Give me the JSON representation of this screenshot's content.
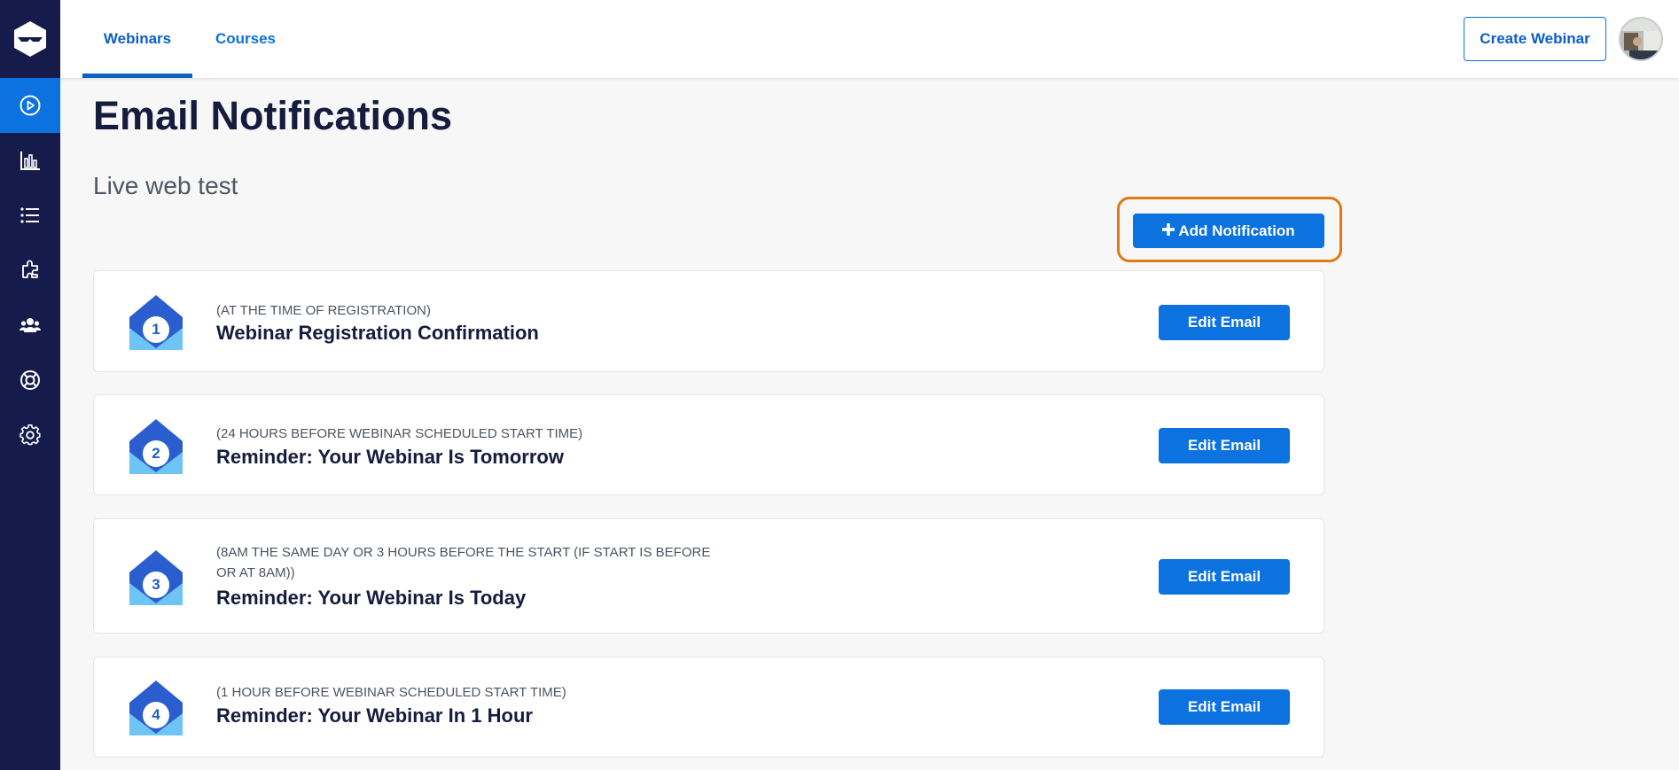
{
  "nav": {
    "tabs": [
      {
        "label": "Webinars",
        "active": true
      },
      {
        "label": "Courses",
        "active": false
      }
    ],
    "create_button": "Create Webinar"
  },
  "sidebar": {
    "items": [
      {
        "icon": "play-circle-icon",
        "active": true
      },
      {
        "icon": "bar-chart-icon",
        "active": false
      },
      {
        "icon": "list-icon",
        "active": false
      },
      {
        "icon": "puzzle-icon",
        "active": false
      },
      {
        "icon": "users-icon",
        "active": false
      },
      {
        "icon": "lifebuoy-icon",
        "active": false
      },
      {
        "icon": "gear-icon",
        "active": false
      }
    ]
  },
  "page": {
    "title": "Email Notifications",
    "subtitle": "Live web test",
    "add_button": "Add Notification"
  },
  "notifications": [
    {
      "number": "1",
      "timing": "(AT THE TIME OF REGISTRATION)",
      "title": "Webinar Registration Confirmation",
      "button": "Edit Email"
    },
    {
      "number": "2",
      "timing": "(24 HOURS BEFORE WEBINAR SCHEDULED START TIME)",
      "title": "Reminder: Your Webinar Is Tomorrow",
      "button": "Edit Email"
    },
    {
      "number": "3",
      "timing": "(8AM THE SAME DAY OR 3 HOURS BEFORE THE START (IF START IS BEFORE OR AT 8AM))",
      "title": "Reminder: Your Webinar Is Today",
      "button": "Edit Email"
    },
    {
      "number": "4",
      "timing": "(1 HOUR BEFORE WEBINAR SCHEDULED START TIME)",
      "title": "Reminder: Your Webinar In 1 Hour",
      "button": "Edit Email"
    }
  ],
  "colors": {
    "sidebar": "#151c4b",
    "accent": "#0c72e0",
    "highlight": "#e07a12"
  }
}
